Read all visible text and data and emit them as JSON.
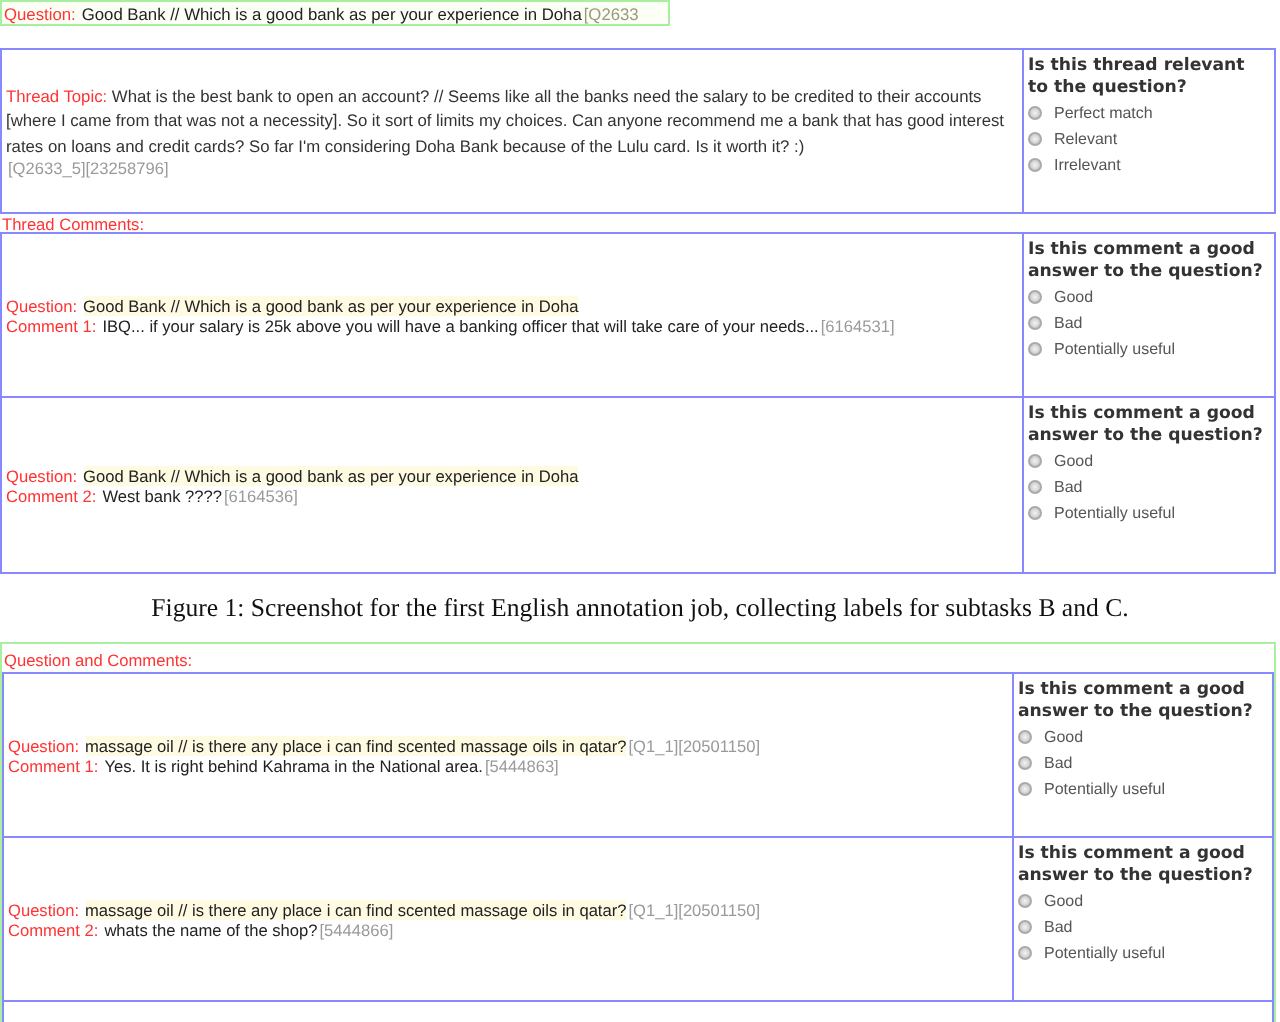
{
  "figures": [
    {
      "question_bar": {
        "label": "Question:",
        "text": "Good Bank // Which is a good bank as per your experience in Doha",
        "id": "[Q2633"
      },
      "thread": {
        "label": "Thread Topic:",
        "text": "What is the best bank to open an account? // Seems like all the banks need the salary to be credited to their accounts [where I came from that was not a necessity]. So it sort of limits my choices. Can anyone recommend me a bank that has good interest rates on loans and credit cards? So far I'm considering Doha Bank because of the Lulu card. Is it worth it? :)",
        "id": "[Q2633_5][23258796]",
        "prompt": "Is this thread relevant to the question?",
        "options": [
          {
            "label": "Perfect match",
            "selected": false
          },
          {
            "label": "Relevant",
            "selected": false
          },
          {
            "label": "Irrelevant",
            "selected": false
          }
        ]
      },
      "section_label": "Thread Comments:",
      "comments": [
        {
          "question_label": "Question:",
          "question_text": "Good Bank // Which is a good bank as per your experience in Doha",
          "comment_label": "Comment 1:",
          "comment_text": "IBQ... if your salary is 25k above you will have a banking officer that will take care of your needs...",
          "comment_id": "[6164531]",
          "prompt": "Is this comment a good answer to the question?",
          "options": [
            {
              "label": "Good",
              "selected": false
            },
            {
              "label": "Bad",
              "selected": false
            },
            {
              "label": "Potentially useful",
              "selected": false
            }
          ]
        },
        {
          "question_label": "Question:",
          "question_text": "Good Bank // Which is a good bank as per your experience in Doha",
          "comment_label": "Comment 2:",
          "comment_text": "West bank ????",
          "comment_id": "[6164536]",
          "prompt": "Is this comment a good answer to the question?",
          "options": [
            {
              "label": "Good",
              "selected": false
            },
            {
              "label": "Bad",
              "selected": false
            },
            {
              "label": "Potentially useful",
              "selected": false
            }
          ]
        }
      ],
      "caption": "Figure 1: Screenshot for the first English annotation job, collecting labels for subtasks B and C."
    },
    {
      "section_label": "Question and Comments:",
      "comments": [
        {
          "question_label": "Question:",
          "question_text": "massage oil // is there any place i can find scented massage oils in qatar?",
          "question_id": "[Q1_1][20501150]",
          "comment_label": "Comment 1:",
          "comment_text": "Yes. It is right behind Kahrama in the National area.",
          "comment_id": "[5444863]",
          "prompt": "Is this comment a good answer to the question?",
          "options": [
            {
              "label": "Good",
              "selected": false
            },
            {
              "label": "Bad",
              "selected": false
            },
            {
              "label": "Potentially useful",
              "selected": false
            }
          ]
        },
        {
          "question_label": "Question:",
          "question_text": "massage oil // is there any place i can find scented massage oils in qatar?",
          "question_id": "[Q1_1][20501150]",
          "comment_label": "Comment 2:",
          "comment_text": "whats the name of the shop?",
          "comment_id": "[5444866]",
          "prompt": "Is this comment a good answer to the question?",
          "options": [
            {
              "label": "Good",
              "selected": false
            },
            {
              "label": "Bad",
              "selected": false
            },
            {
              "label": "Potentially useful",
              "selected": false
            }
          ]
        }
      ]
    }
  ]
}
